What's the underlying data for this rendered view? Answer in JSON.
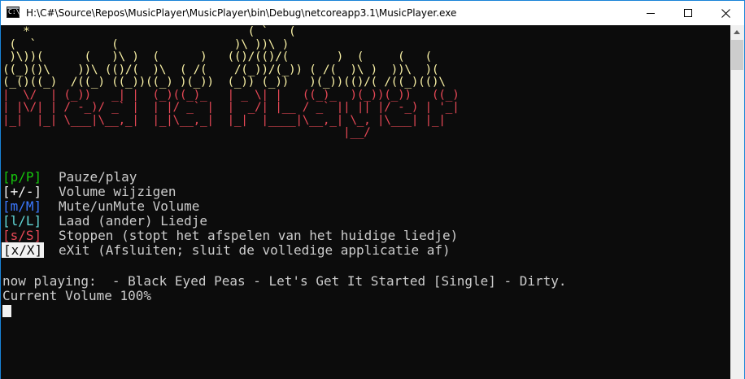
{
  "window": {
    "title": "H:\\C#\\Source\\Repos\\MusicPlayer\\MusicPlayer\\bin\\Debug\\netcoreapp3.1\\MusicPlayer.exe",
    "icon": "console-app-icon",
    "controls": {
      "minimize": "minimize-icon",
      "maximize": "maximize-icon",
      "close": "close-icon"
    }
  },
  "banner": {
    "art_text": "MediaPlayer",
    "lines": [
      "   *                                ( `   (",
      " (  `           (                 )\\ ))\\ )",
      " )\\))(      (   )\\ )  (      )   (()/(()/(       )  (     (   (",
      "((_)()\\    ))\\ (()/(  )\\  ( /(    /(_))/(_)) ( /(  )\\ )  ))\\  )(",
      "(_()((_)  /((_) ((_))((_) )(_))  (_)) (_))   )(_))(()/( /((_)(()\\",
      "|  \\/  | (_))   _| |  (_)((_)_   | _ \\| |   ((_)_  )(_))(_))   ((_)",
      "| |\\/| | / -_)/ _` |  | |/ _` |  |  _/| |__ / _` || || |/ -_) | '_|",
      "|_|  |_| \\___|\\__,_|  |_|\\__,_|  |_|  |____|\\__,_| \\_, |\\___| |_|",
      "                                                  |__/"
    ]
  },
  "menu": [
    {
      "key": "[p/P]",
      "label": "Pauze/play",
      "color": "#16c60c"
    },
    {
      "key": "[+/-]",
      "label": "Volume wijzigen",
      "color": "#f2f2f2"
    },
    {
      "key": "[m/M]",
      "label": "Mute/unMute Volume",
      "color": "#3b78ff"
    },
    {
      "key": "[l/L]",
      "label": "Laad (ander) Liedje",
      "color": "#61d6d6"
    },
    {
      "key": "[s/S]",
      "label": "Stoppen (stopt het afspelen van het huidige liedje)",
      "color": "#e74856"
    },
    {
      "key": "[x/X]",
      "label": "eXit (Afsluiten; sluit de volledige applicatie af)",
      "color": "#0c0c0c"
    }
  ],
  "status": {
    "now_playing": "now playing:  - Black Eyed Peas - Let's Get It Started [Single] - Dirty.",
    "volume": "Current Volume 100%"
  },
  "colors": {
    "console_bg": "#0c0c0c",
    "text": "#cccccc",
    "banner_flame": "#f9f1a5",
    "banner_letters": "#e74856",
    "window_border": "#1883d7"
  }
}
